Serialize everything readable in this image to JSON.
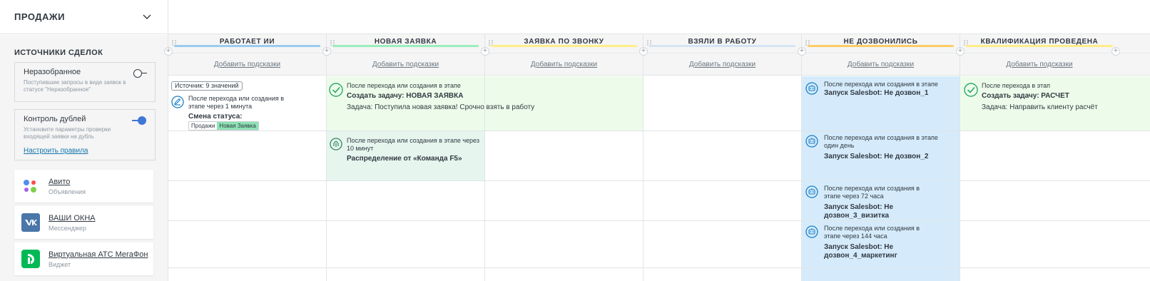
{
  "pipeline": {
    "title": "ПРОДАЖИ"
  },
  "sources": {
    "title": "ИСТОЧНИКИ СДЕЛОК",
    "unsorted": {
      "title": "Неразобранное",
      "desc": "Поступившие запросы в виде заявок в статусе \"Неразобранное\""
    },
    "duplicates": {
      "title": "Контроль дублей",
      "desc": "Установите параметры проверки входящей заявки на дубль",
      "link": "Настроить правила"
    },
    "items": [
      {
        "name": "Авито",
        "sub": "Объявления",
        "icon": "avito-icon"
      },
      {
        "name": "ВАШИ ОКНА",
        "sub": "Мессенджер",
        "icon": "vk-icon"
      },
      {
        "name": "Виртуальная АТС МегаФон",
        "sub": "Виджет",
        "icon": "megafon-icon"
      }
    ]
  },
  "colors": {
    "stage_ai": "#99ccee",
    "stage_new": "#99eebb",
    "stage_call": "#ffee88",
    "stage_work": "#d4e4f4",
    "stage_nocall": "#ffcc66",
    "stage_qual": "#ffee88",
    "green_fill": "#edfcea",
    "blue_fill": "#d5ebfb",
    "teal_fill": "#e6f5ee"
  },
  "hint_label": "Добавить подсказки",
  "columns": [
    {
      "title": "РАБОТАЕТ ИИ"
    },
    {
      "title": "НОВАЯ ЗАЯВКА"
    },
    {
      "title": "ЗАЯВКА ПО ЗВОНКУ"
    },
    {
      "title": "ВЗЯЛИ В РАБОТУ"
    },
    {
      "title": "НЕ ДОЗВОНИЛИСЬ"
    },
    {
      "title": "КВАЛИФИКАЦИЯ ПРОВЕДЕНА"
    }
  ],
  "automations": {
    "ai": {
      "source_badge": "Источник: 9 значений",
      "trigger": "После перехода или создания в этапе через 1 минута",
      "action": "Смена статуса:",
      "chip_pipeline": "Продажи",
      "chip_stage": "Новая Заявка"
    },
    "new_task": {
      "trigger": "После перехода или создания в этапе",
      "action": "Создать задачу: НОВАЯ ЗАЯВКА",
      "detail": "Задача: Поступила новая заявка! Срочно взять в работу"
    },
    "new_distribution": {
      "trigger": "После перехода или создания в этапе через 10 минут",
      "action": "Распределение от «Команда F5»"
    },
    "nocall": [
      {
        "trigger": "После перехода или создания в этапе",
        "action": "Запуск Salesbot: Не дозвон_1"
      },
      {
        "trigger": "После перехода или создания в этапе один день",
        "action": "Запуск Salesbot: Не дозвон_2"
      },
      {
        "trigger": "После перехода или создания в этапе через 72 часа",
        "action": "Запуск Salesbot: Не дозвон_3_визитка"
      },
      {
        "trigger": "После перехода или создания в этапе через 144 часа",
        "action": "Запуск Salesbot: Не дозвон_4_маркетинг"
      }
    ],
    "qual_task": {
      "trigger": "После перехода в этап",
      "action": "Создать задачу: РАСЧЕТ",
      "detail": "Задача: Направить клиенту расчёт"
    }
  }
}
